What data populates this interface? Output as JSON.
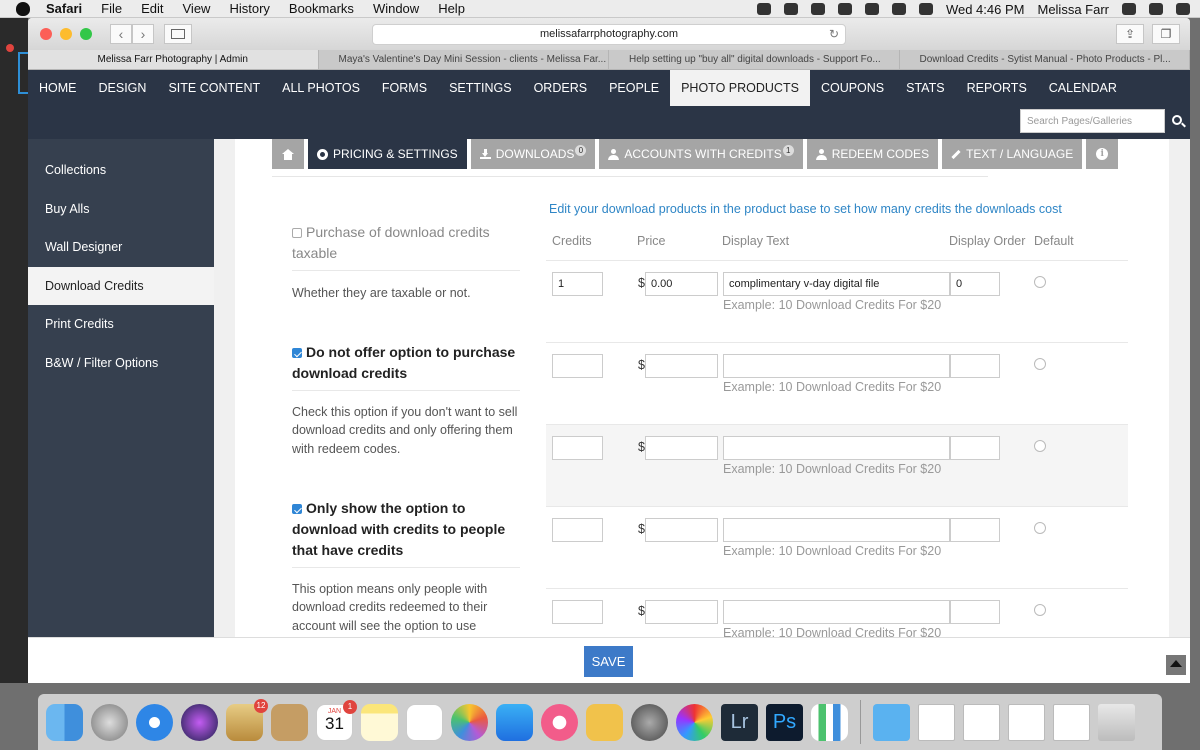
{
  "menubar": {
    "app": "Safari",
    "items": [
      "File",
      "Edit",
      "View",
      "History",
      "Bookmarks",
      "Window",
      "Help"
    ],
    "clock": "Wed 4:46 PM",
    "user": "Melissa Farr"
  },
  "browser": {
    "url": "melissafarrphotography.com",
    "tabs": [
      "Melissa Farr Photography | Admin",
      "Maya's Valentine's Day Mini Session - clients - Melissa Far...",
      "Help setting up \"buy all\" digital downloads - Support Fo...",
      "Download Credits - Sytist Manual - Photo Products - Pl..."
    ]
  },
  "topnav": [
    "HOME",
    "DESIGN",
    "SITE CONTENT",
    "ALL PHOTOS",
    "FORMS",
    "SETTINGS",
    "ORDERS",
    "PEOPLE",
    "PHOTO PRODUCTS",
    "COUPONS",
    "STATS",
    "REPORTS",
    "CALENDAR"
  ],
  "search": {
    "placeholder": "Search Pages/Galleries"
  },
  "sidebar": [
    "Collections",
    "Buy Alls",
    "Wall Designer",
    "Download Credits",
    "Print Credits",
    "B&W / Filter Options"
  ],
  "subtabs": {
    "pricing": "PRICING & SETTINGS",
    "downloads": "DOWNLOADS",
    "downloads_count": "0",
    "accounts": "ACCOUNTS WITH CREDITS",
    "accounts_count": "1",
    "redeem": "REDEEM CODES",
    "text": "TEXT / LANGUAGE"
  },
  "options": {
    "taxable_title": "Purchase of download credits taxable",
    "taxable_desc": "Whether they are taxable or not.",
    "no_offer_title": "Do not offer option to purchase download credits",
    "no_offer_desc": "Check this option if you don't want to sell download credits and only offering them with redeem codes.",
    "only_show_title": "Only show the option to download with credits to people that have credits",
    "only_show_desc": "This option means only people with download credits redeemed to their account will see the option to use download credits."
  },
  "table": {
    "note": "Edit your download products in the product base to set how many credits the downloads cost",
    "headers": [
      "Credits",
      "Price",
      "Display Text",
      "Display Order",
      "Default"
    ],
    "currency": "$",
    "rows": [
      {
        "credits": "1",
        "price": "0.00",
        "text": "complimentary v-day digital file",
        "order": "0",
        "example": "Example: 10 Download Credits For $20"
      },
      {
        "credits": "",
        "price": "",
        "text": "",
        "order": "",
        "example": "Example: 10 Download Credits For $20"
      },
      {
        "credits": "",
        "price": "",
        "text": "",
        "order": "",
        "example": "Example: 10 Download Credits For $20"
      },
      {
        "credits": "",
        "price": "",
        "text": "",
        "order": "",
        "example": "Example: 10 Download Credits For $20"
      },
      {
        "credits": "",
        "price": "",
        "text": "",
        "order": "",
        "example": "Example: 10 Download Credits For $20"
      }
    ]
  },
  "footer": {
    "save": "SAVE"
  },
  "dock": {
    "mail_badge": "12",
    "calendar_badge": "1",
    "calendar_month": "JAN",
    "calendar_day": "31",
    "lr": "Lr",
    "ps": "Ps"
  }
}
